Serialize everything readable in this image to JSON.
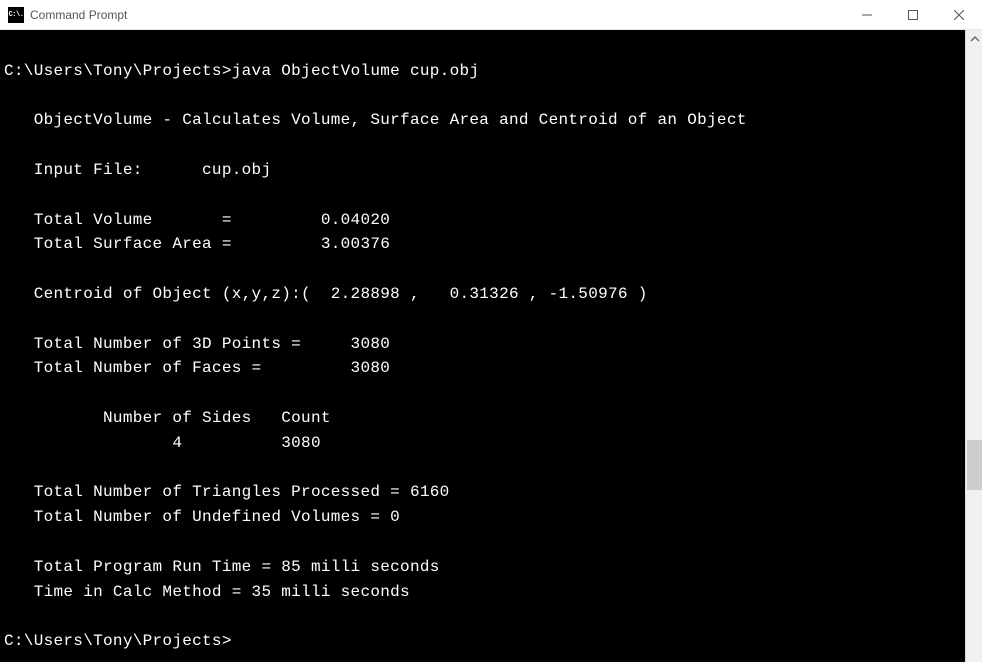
{
  "window": {
    "title": "Command Prompt",
    "icon_label": "C:\\."
  },
  "terminal": {
    "prompt1_path": "C:\\Users\\Tony\\Projects>",
    "prompt1_cmd": "java ObjectVolume cup.obj",
    "header": "   ObjectVolume - Calculates Volume, Surface Area and Centroid of an Object",
    "input_file_line": "   Input File:      cup.obj",
    "volume_line": "   Total Volume       =         0.04020",
    "surface_line": "   Total Surface Area =         3.00376",
    "centroid_line": "   Centroid of Object (x,y,z):(  2.28898 ,   0.31326 , -1.50976 )",
    "points_line": "   Total Number of 3D Points =     3080",
    "faces_line": "   Total Number of Faces =         3080",
    "sides_header": "          Number of Sides   Count",
    "sides_row": "                 4          3080",
    "triangles_line": "   Total Number of Triangles Processed = 6160",
    "undefined_line": "   Total Number of Undefined Volumes = 0",
    "runtime_line": "   Total Program Run Time = 85 milli seconds",
    "calctime_line": "   Time in Calc Method = 35 milli seconds",
    "prompt2_path": "C:\\Users\\Tony\\Projects>"
  }
}
